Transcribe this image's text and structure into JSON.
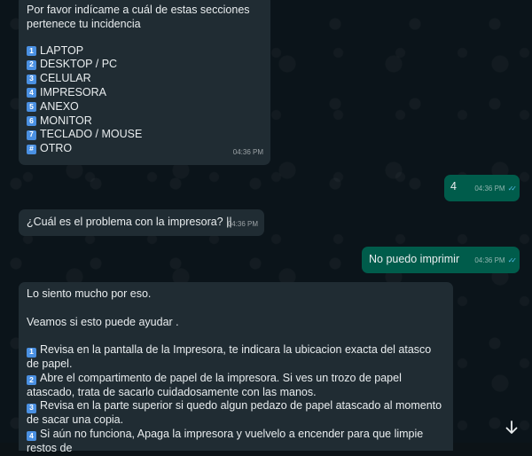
{
  "messages": {
    "m1": {
      "intro": "Por favor indícame a cuál de estas secciones\npertenece tu incidencia",
      "options": [
        {
          "num": "1",
          "label": "LAPTOP"
        },
        {
          "num": "2",
          "label": "DESKTOP / PC"
        },
        {
          "num": "3",
          "label": "CELULAR"
        },
        {
          "num": "4",
          "label": "IMPRESORA"
        },
        {
          "num": "5",
          "label": "ANEXO"
        },
        {
          "num": "6",
          "label": "MONITOR"
        },
        {
          "num": "7",
          "label": "TECLADO / MOUSE"
        },
        {
          "num": "#",
          "label": "OTRO"
        }
      ],
      "time": "04:36 PM"
    },
    "m2": {
      "text": "4",
      "time": "04:36 PM"
    },
    "m3": {
      "text": "¿Cuál es el problema con la impresora? ||",
      "time": "04:36 PM"
    },
    "m4": {
      "text": "No puedo imprimir",
      "time": "04:36 PM"
    },
    "m5": {
      "p1": "Lo siento mucho por eso.",
      "p2": "Veamos si esto puede ayudar .",
      "steps": [
        {
          "num": "1",
          "text": "Revisa en la pantalla de la Impresora,  te indicara la ubicacion exacta del atasco de papel."
        },
        {
          "num": "2",
          "text": "Abre el compartimento de papel de la impresora. Si ves un trozo de papel atascado, trata de sacarlo cuidadosamente con las manos."
        },
        {
          "num": "3",
          "text": "Revisa en la parte superior si quedo algun pedazo de papel atascado al momento de sacar una copia."
        },
        {
          "num": "4",
          "text": "Si aún no funciona, Apaga la impresora y vuelvelo a encender para que limpie restos de"
        }
      ]
    }
  },
  "colors": {
    "incoming": "#202c33",
    "outgoing": "#005c4b",
    "ticks": "#53bdeb",
    "number_badge": "#4a90e2"
  },
  "icons": {
    "read_ticks": "double-check-icon",
    "scroll_down": "arrow-down-icon"
  }
}
